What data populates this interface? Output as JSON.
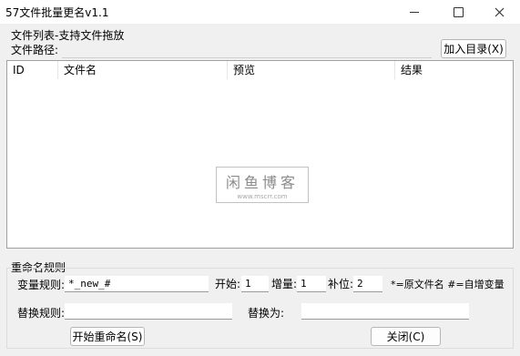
{
  "window": {
    "title": "57文件批量更名v1.1"
  },
  "file_group": {
    "label": "文件列表-支持文件拖放"
  },
  "path": {
    "label": "文件路径:",
    "value": ""
  },
  "add_dir_button": "加入目录(X)",
  "list": {
    "columns": [
      "ID",
      "文件名",
      "预览",
      "结果"
    ],
    "rows": []
  },
  "watermark": {
    "title": "闲鱼博客",
    "url": "www.mscrr.com"
  },
  "rename_group": {
    "label": "重命名规则"
  },
  "var_rule": {
    "label": "变量规则:",
    "value": "*_new_#"
  },
  "start": {
    "label": "开始:",
    "value": "1"
  },
  "increment": {
    "label": "增量:",
    "value": "1"
  },
  "padding": {
    "label": "补位:",
    "value": "2"
  },
  "legend_text": "*=原文件名 #=自增变量",
  "replace_rule": {
    "label": "替换规则:",
    "value": ""
  },
  "replace_with": {
    "label": "替换为:",
    "value": ""
  },
  "start_rename_button": "开始重命名(S)",
  "close_button": "关闭(C)"
}
